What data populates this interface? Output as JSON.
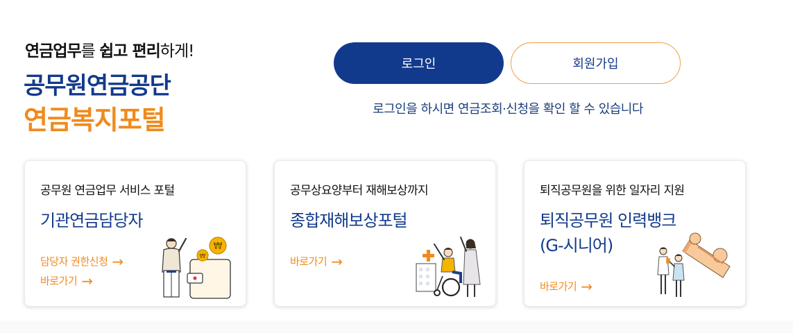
{
  "hero": {
    "tagline_bold_1": "연금업무",
    "tagline_mid": "를 ",
    "tagline_bold_2": "쉽고 편리",
    "tagline_end": "하게!",
    "org_name": "공무원연금공단",
    "portal_name": "연금복지포털"
  },
  "auth": {
    "login_label": "로그인",
    "join_label": "회원가입",
    "note": "로그인을 하시면 연금조회·신청을 확인 할 수 있습니다"
  },
  "cards": [
    {
      "subtitle": "공무원 연금업무 서비스 포털",
      "title": "기관연금담당자",
      "link_1": "담당자 권한신청",
      "link_2": "바로가기"
    },
    {
      "subtitle": "공무상요양부터 재해보상까지",
      "title": "종합재해보상포털",
      "link_1": "바로가기"
    },
    {
      "subtitle": "퇴직공무원을 위한 일자리 지원",
      "title_line1": "퇴직공무원 인력뱅크",
      "title_line2": "(G-시니어)",
      "link_1": "바로가기"
    }
  ],
  "icons": {
    "arrow": "→",
    "coin_symbol": "₩",
    "card1_illustration": "person-with-coins-and-wallet-illustration",
    "card2_illustration": "wheelchair-hospital-illustration",
    "card3_illustration": "people-with-giant-pencil-illustration"
  },
  "colors": {
    "primary": "#123a8c",
    "accent": "#f08a1c"
  }
}
